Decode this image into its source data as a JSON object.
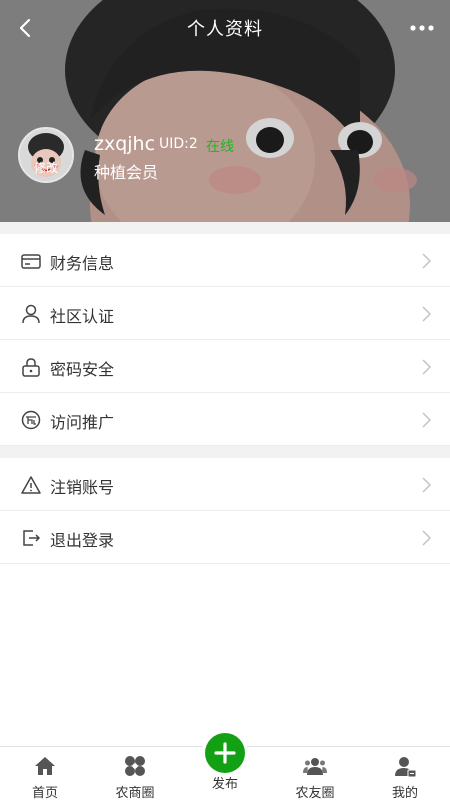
{
  "header": {
    "title": "个人资料",
    "back_icon": "chevron-left-icon",
    "more_icon": "more-dots-icon"
  },
  "profile": {
    "avatar_edit_label": "修改",
    "username": "zxqjhc",
    "uid": "UID:2",
    "status": "在线",
    "status_color": "#1db81d",
    "member_level": "种植会员"
  },
  "menu": {
    "group1": [
      {
        "label": "财务信息",
        "icon": "credit-card-icon"
      },
      {
        "label": "社区认证",
        "icon": "user-icon"
      },
      {
        "label": "密码安全",
        "icon": "lock-icon"
      },
      {
        "label": "访问推广",
        "icon": "promotion-icon"
      }
    ],
    "group2": [
      {
        "label": "注销账号",
        "icon": "warning-icon"
      },
      {
        "label": "退出登录",
        "icon": "logout-icon"
      }
    ]
  },
  "tabbar": {
    "accent": "#14a014",
    "tabs": [
      {
        "label": "首页",
        "icon": "home-icon"
      },
      {
        "label": "农商圈",
        "icon": "grid-circles-icon"
      },
      {
        "label": "发布",
        "icon": "plus-icon"
      },
      {
        "label": "农友圈",
        "icon": "friends-icon"
      },
      {
        "label": "我的",
        "icon": "profile-icon"
      }
    ]
  }
}
